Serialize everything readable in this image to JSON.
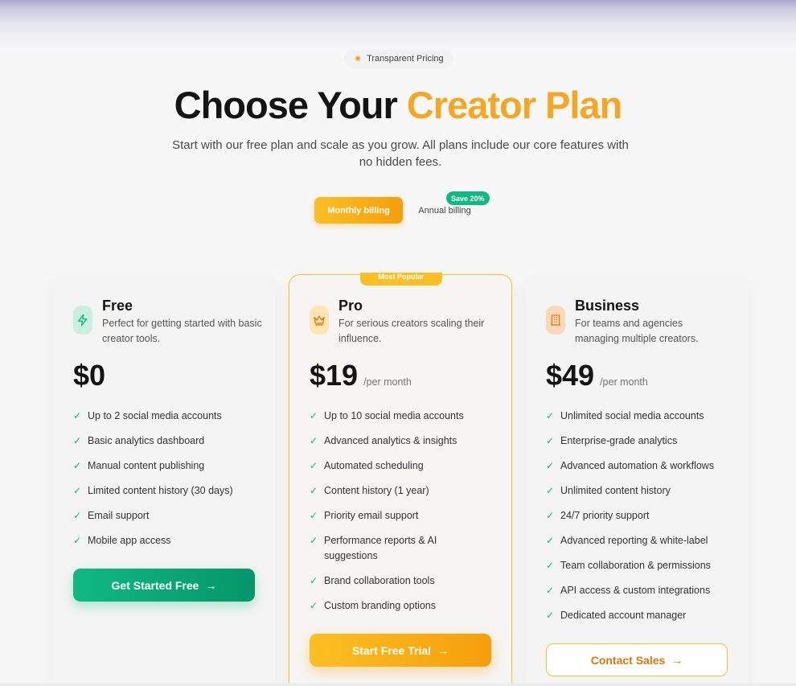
{
  "header": {
    "pill_icon": "sparkle-icon",
    "pill_label": "Transparent Pricing",
    "title_main": "Choose Your",
    "title_accent": "Creator Plan",
    "subtitle": "Start with our free plan and scale as you grow. All plans include our core features with no hidden fees."
  },
  "billing": {
    "monthly_label": "Monthly billing",
    "annual_label": "Annual billing",
    "save_badge": "Save 20%"
  },
  "plans": [
    {
      "name": "Free",
      "icon": "bolt-icon",
      "description": "Perfect for getting started with basic creator tools.",
      "price": "$0",
      "period": "",
      "features": [
        "Up to 2 social media accounts",
        "Basic analytics dashboard",
        "Manual content publishing",
        "Limited content history (30 days)",
        "Email support",
        "Mobile app access"
      ],
      "cta": "Get Started Free"
    },
    {
      "name": "Pro",
      "icon": "crown-icon",
      "badge": "Most Popular",
      "description": "For serious creators scaling their influence.",
      "price": "$19",
      "period": "/per month",
      "features": [
        "Up to 10 social media accounts",
        "Advanced analytics & insights",
        "Automated scheduling",
        "Content history (1 year)",
        "Priority email support",
        "Performance reports & AI suggestions",
        "Brand collaboration tools",
        "Custom branding options"
      ],
      "cta": "Start Free Trial"
    },
    {
      "name": "Business",
      "icon": "building-icon",
      "description": "For teams and agencies managing multiple creators.",
      "price": "$49",
      "period": "/per month",
      "features": [
        "Unlimited social media accounts",
        "Enterprise-grade analytics",
        "Advanced automation & workflows",
        "Unlimited content history",
        "24/7 priority support",
        "Advanced reporting & white-label",
        "Team collaboration & permissions",
        "API access & custom integrations",
        "Dedicated account manager"
      ],
      "cta": "Contact Sales"
    }
  ],
  "colors": {
    "accent": "#f5a623",
    "green": "#10b981",
    "text": "#141414"
  }
}
